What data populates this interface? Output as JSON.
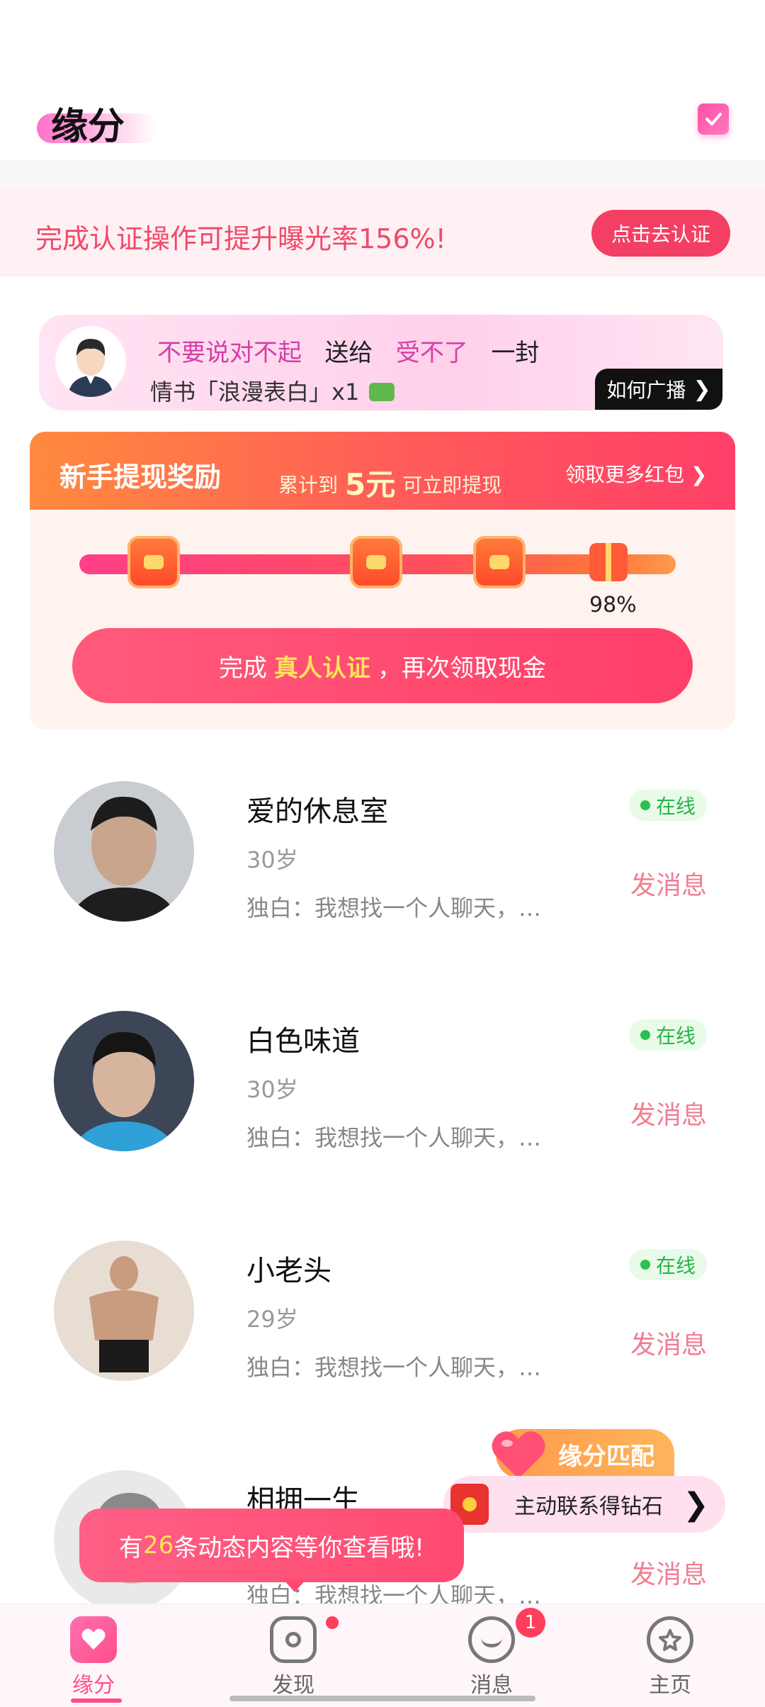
{
  "header": {
    "title": "缘分"
  },
  "verify_banner": {
    "text": "完成认证操作可提升曝光率156%!",
    "button": "点击去认证"
  },
  "broadcast": {
    "part1": "不要说对不起",
    "part2": "送给",
    "part3": "受不了",
    "part4": "一封",
    "line2": "情书「浪漫表白」x1",
    "button": "如何广播"
  },
  "reward": {
    "title": "新手提现奖励",
    "accum": "累计到",
    "amount": "5元",
    "withdraw": "可立即提现",
    "more": "领取更多红包",
    "progress": 0.98,
    "progress_label": "98%",
    "cta_prefix": "完成",
    "cta_highlight": "真人认证",
    "cta_suffix": "，再次领取现金"
  },
  "users": [
    {
      "name": "爱的休息室",
      "age": "30岁",
      "status": "在线",
      "monologue": "独白：我想找一个人聊天，…",
      "action": "发消息"
    },
    {
      "name": "白色味道",
      "age": "30岁",
      "status": "在线",
      "monologue": "独白：我想找一个人聊天，…",
      "action": "发消息"
    },
    {
      "name": "小老头",
      "age": "29岁",
      "status": "在线",
      "monologue": "独白：我想找一个人聊天，…",
      "action": "发消息"
    },
    {
      "name": "相拥一生",
      "age": "",
      "status": "",
      "monologue": "独白：我想找一个人聊天，…",
      "action": "发消息"
    }
  ],
  "floating": {
    "match_label": "缘分匹配",
    "contact_text": "主动联系得钻石",
    "toast_prefix": "有",
    "toast_count": "26",
    "toast_suffix": "条动态内容等你查看哦!"
  },
  "tabs": [
    {
      "label": "缘分",
      "icon": "home-heart-icon",
      "active": true
    },
    {
      "label": "发现",
      "icon": "camera-icon",
      "dot": true
    },
    {
      "label": "消息",
      "icon": "chat-icon",
      "badge": "1"
    },
    {
      "label": "主页",
      "icon": "profile-icon"
    }
  ],
  "colors": {
    "accent": "#ff4f8a",
    "banner_button": "#f33f63",
    "online": "#2bc04f"
  }
}
